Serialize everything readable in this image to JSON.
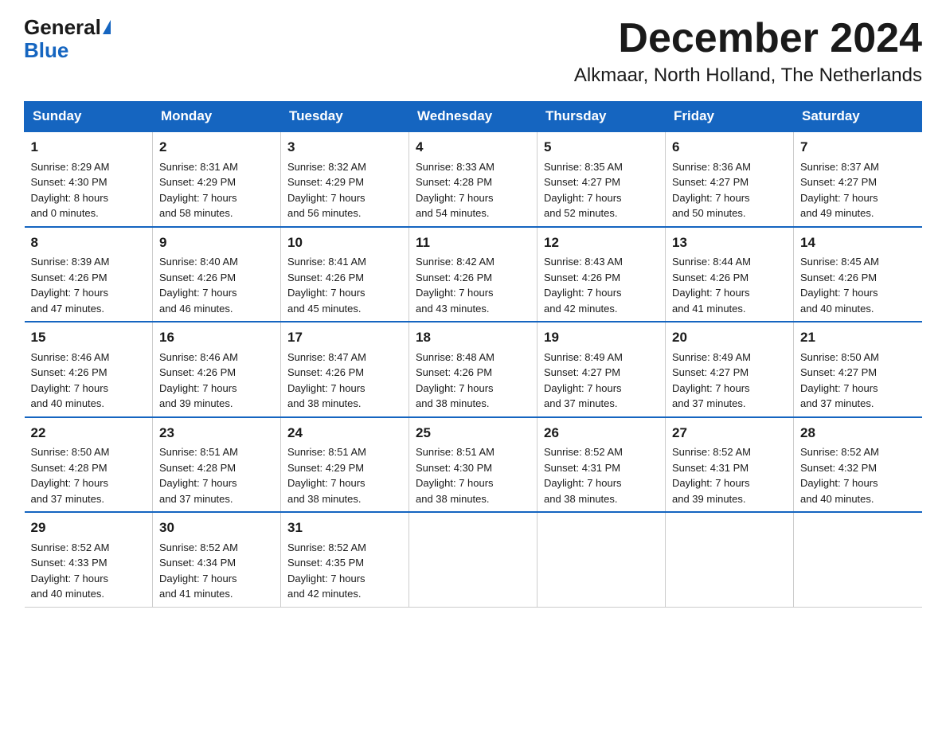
{
  "header": {
    "logo_general": "General",
    "logo_blue": "Blue",
    "title": "December 2024",
    "subtitle": "Alkmaar, North Holland, The Netherlands"
  },
  "days_of_week": [
    "Sunday",
    "Monday",
    "Tuesday",
    "Wednesday",
    "Thursday",
    "Friday",
    "Saturday"
  ],
  "weeks": [
    [
      {
        "day": "1",
        "info": "Sunrise: 8:29 AM\nSunset: 4:30 PM\nDaylight: 8 hours\nand 0 minutes."
      },
      {
        "day": "2",
        "info": "Sunrise: 8:31 AM\nSunset: 4:29 PM\nDaylight: 7 hours\nand 58 minutes."
      },
      {
        "day": "3",
        "info": "Sunrise: 8:32 AM\nSunset: 4:29 PM\nDaylight: 7 hours\nand 56 minutes."
      },
      {
        "day": "4",
        "info": "Sunrise: 8:33 AM\nSunset: 4:28 PM\nDaylight: 7 hours\nand 54 minutes."
      },
      {
        "day": "5",
        "info": "Sunrise: 8:35 AM\nSunset: 4:27 PM\nDaylight: 7 hours\nand 52 minutes."
      },
      {
        "day": "6",
        "info": "Sunrise: 8:36 AM\nSunset: 4:27 PM\nDaylight: 7 hours\nand 50 minutes."
      },
      {
        "day": "7",
        "info": "Sunrise: 8:37 AM\nSunset: 4:27 PM\nDaylight: 7 hours\nand 49 minutes."
      }
    ],
    [
      {
        "day": "8",
        "info": "Sunrise: 8:39 AM\nSunset: 4:26 PM\nDaylight: 7 hours\nand 47 minutes."
      },
      {
        "day": "9",
        "info": "Sunrise: 8:40 AM\nSunset: 4:26 PM\nDaylight: 7 hours\nand 46 minutes."
      },
      {
        "day": "10",
        "info": "Sunrise: 8:41 AM\nSunset: 4:26 PM\nDaylight: 7 hours\nand 45 minutes."
      },
      {
        "day": "11",
        "info": "Sunrise: 8:42 AM\nSunset: 4:26 PM\nDaylight: 7 hours\nand 43 minutes."
      },
      {
        "day": "12",
        "info": "Sunrise: 8:43 AM\nSunset: 4:26 PM\nDaylight: 7 hours\nand 42 minutes."
      },
      {
        "day": "13",
        "info": "Sunrise: 8:44 AM\nSunset: 4:26 PM\nDaylight: 7 hours\nand 41 minutes."
      },
      {
        "day": "14",
        "info": "Sunrise: 8:45 AM\nSunset: 4:26 PM\nDaylight: 7 hours\nand 40 minutes."
      }
    ],
    [
      {
        "day": "15",
        "info": "Sunrise: 8:46 AM\nSunset: 4:26 PM\nDaylight: 7 hours\nand 40 minutes."
      },
      {
        "day": "16",
        "info": "Sunrise: 8:46 AM\nSunset: 4:26 PM\nDaylight: 7 hours\nand 39 minutes."
      },
      {
        "day": "17",
        "info": "Sunrise: 8:47 AM\nSunset: 4:26 PM\nDaylight: 7 hours\nand 38 minutes."
      },
      {
        "day": "18",
        "info": "Sunrise: 8:48 AM\nSunset: 4:26 PM\nDaylight: 7 hours\nand 38 minutes."
      },
      {
        "day": "19",
        "info": "Sunrise: 8:49 AM\nSunset: 4:27 PM\nDaylight: 7 hours\nand 37 minutes."
      },
      {
        "day": "20",
        "info": "Sunrise: 8:49 AM\nSunset: 4:27 PM\nDaylight: 7 hours\nand 37 minutes."
      },
      {
        "day": "21",
        "info": "Sunrise: 8:50 AM\nSunset: 4:27 PM\nDaylight: 7 hours\nand 37 minutes."
      }
    ],
    [
      {
        "day": "22",
        "info": "Sunrise: 8:50 AM\nSunset: 4:28 PM\nDaylight: 7 hours\nand 37 minutes."
      },
      {
        "day": "23",
        "info": "Sunrise: 8:51 AM\nSunset: 4:28 PM\nDaylight: 7 hours\nand 37 minutes."
      },
      {
        "day": "24",
        "info": "Sunrise: 8:51 AM\nSunset: 4:29 PM\nDaylight: 7 hours\nand 38 minutes."
      },
      {
        "day": "25",
        "info": "Sunrise: 8:51 AM\nSunset: 4:30 PM\nDaylight: 7 hours\nand 38 minutes."
      },
      {
        "day": "26",
        "info": "Sunrise: 8:52 AM\nSunset: 4:31 PM\nDaylight: 7 hours\nand 38 minutes."
      },
      {
        "day": "27",
        "info": "Sunrise: 8:52 AM\nSunset: 4:31 PM\nDaylight: 7 hours\nand 39 minutes."
      },
      {
        "day": "28",
        "info": "Sunrise: 8:52 AM\nSunset: 4:32 PM\nDaylight: 7 hours\nand 40 minutes."
      }
    ],
    [
      {
        "day": "29",
        "info": "Sunrise: 8:52 AM\nSunset: 4:33 PM\nDaylight: 7 hours\nand 40 minutes."
      },
      {
        "day": "30",
        "info": "Sunrise: 8:52 AM\nSunset: 4:34 PM\nDaylight: 7 hours\nand 41 minutes."
      },
      {
        "day": "31",
        "info": "Sunrise: 8:52 AM\nSunset: 4:35 PM\nDaylight: 7 hours\nand 42 minutes."
      },
      {
        "day": "",
        "info": ""
      },
      {
        "day": "",
        "info": ""
      },
      {
        "day": "",
        "info": ""
      },
      {
        "day": "",
        "info": ""
      }
    ]
  ]
}
